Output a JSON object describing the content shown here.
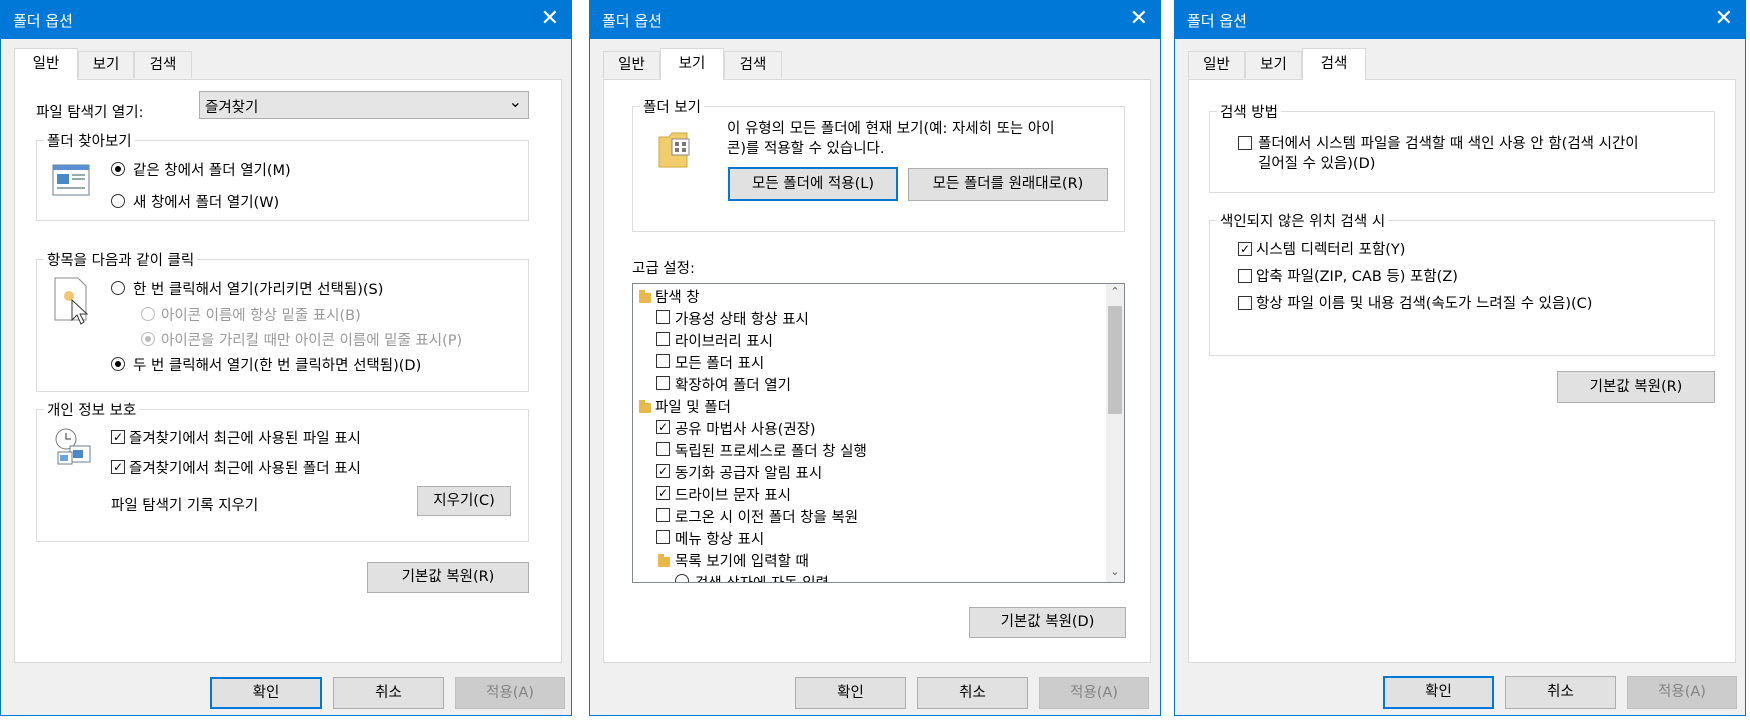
{
  "dialog1": {
    "title": "폴더 옵션",
    "tabs": [
      "일반",
      "보기",
      "검색"
    ],
    "open_explorer_label": "파일 탐색기 열기:",
    "open_explorer_value": "즐겨찾기",
    "browse_group": "폴더 찾아보기",
    "browse_same_window": "같은 창에서 폴더 열기(M)",
    "browse_new_window": "새 창에서 폴더 열기(W)",
    "click_group": "항목을 다음과 같이 클릭",
    "single_click": "한 번 클릭해서 열기(가리키면 선택됨)(S)",
    "underline_always": "아이콘 이름에 항상 밑줄 표시(B)",
    "underline_hover": "아이콘을 가리킬 때만 아이콘 이름에 밑줄 표시(P)",
    "double_click": "두 번 클릭해서 열기(한 번 클릭하면 선택됨)(D)",
    "privacy_group": "개인 정보 보호",
    "recent_files": "즐겨찾기에서 최근에 사용된 파일 표시",
    "recent_folders": "즐겨찾기에서 최근에 사용된 폴더 표시",
    "clear_history_label": "파일 탐색기 기록 지우기",
    "clear_button": "지우기(C)",
    "restore_defaults": "기본값 복원(R)",
    "ok": "확인",
    "cancel": "취소",
    "apply": "적용(A)"
  },
  "dialog2": {
    "title": "폴더 옵션",
    "tabs": [
      "일반",
      "보기",
      "검색"
    ],
    "folder_view_group": "폴더 보기",
    "folder_view_desc_1": "이 유형의 모든 폴더에 현재 보기(예: 자세히 또는 아이",
    "folder_view_desc_2": "콘)를 적용할 수 있습니다.",
    "apply_all_button": "모든 폴더에 적용(L)",
    "reset_all_button": "모든 폴더를 원래대로(R)",
    "advanced_label": "고급 설정:",
    "tree": {
      "nav_pane": "탐색 창",
      "show_availability": "가용성 상태 항상 표시",
      "show_libraries": "라이브러리 표시",
      "show_all_folders": "모든 폴더 표시",
      "expand_to_folder": "확장하여 폴더 열기",
      "files_and_folders": "파일 및 폴더",
      "sharing_wizard": "공유 마법사 사용(권장)",
      "separate_process": "독립된 프로세스로 폴더 창 실행",
      "sync_provider": "동기화 공급자 알림 표시",
      "drive_letters": "드라이브 문자 표시",
      "restore_windows": "로그온 시 이전 폴더 창을 복원",
      "always_menus": "메뉴 항상 표시",
      "list_typing": "목록 보기에 입력할 때",
      "auto_type_search": "검색 상자에 자동 입력"
    },
    "restore_defaults": "기본값 복원(D)",
    "ok": "확인",
    "cancel": "취소",
    "apply": "적용(A)"
  },
  "dialog3": {
    "title": "폴더 옵션",
    "tabs": [
      "일반",
      "보기",
      "검색"
    ],
    "search_method_group": "검색 방법",
    "no_index_1": "폴더에서 시스템 파일을 검색할 때 색인 사용 안 함(검색 시간이",
    "no_index_2": "길어질 수 있음)(D)",
    "nonindexed_group": "색인되지 않은 위치 검색 시",
    "include_system_dirs": "시스템 디렉터리 포함(Y)",
    "include_compressed": "압축 파일(ZIP, CAB 등) 포함(Z)",
    "search_names_contents": "항상 파일 이름 및 내용 검색(속도가 느려질 수 있음)(C)",
    "restore_defaults": "기본값 복원(R)",
    "ok": "확인",
    "cancel": "취소",
    "apply": "적용(A)"
  },
  "glyphs": {
    "close": "✕",
    "check": "✓",
    "chevron_down": "⌄",
    "arrow_up": "⌃",
    "arrow_down": "⌄"
  },
  "colors": {
    "accent": "#0078d7",
    "folder": "#e8b84b"
  }
}
